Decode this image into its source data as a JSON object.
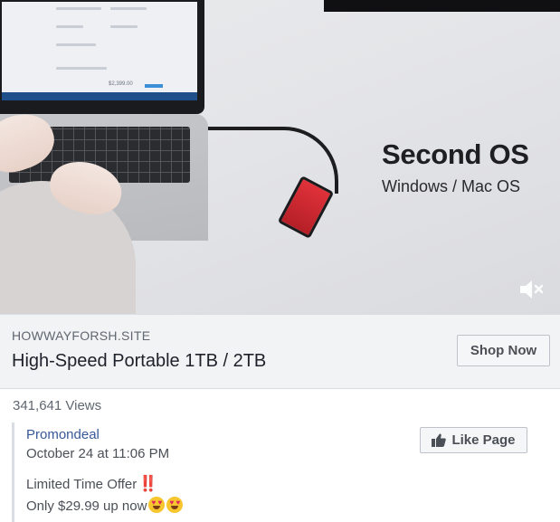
{
  "video": {
    "overlay_title": "Second OS",
    "overlay_subtitle": "Windows / Mac OS",
    "laptop_screen_price": "$2,399.00",
    "mute_icon": "speaker-muted-icon"
  },
  "link_preview": {
    "domain": "HOWWAYFORSH.SITE",
    "headline": "High-Speed Portable 1TB / 2TB",
    "cta_label": "Shop Now"
  },
  "views": "341,641 Views",
  "post": {
    "page_name": "Promondeal",
    "date": "October 24 at 11:06 PM",
    "line1": "Limited Time Offer",
    "line1_emoji": "‼️",
    "line2": "Only $29.99 up now",
    "line2_emoji": "heart-eyes-emoji",
    "like_label": "Like Page",
    "like_icon": "thumbs-up-icon"
  },
  "colors": {
    "link_blue": "#385898",
    "button_bg": "#f5f6f7",
    "preview_bg": "#f2f3f5",
    "drive_red": "#e0313a"
  }
}
